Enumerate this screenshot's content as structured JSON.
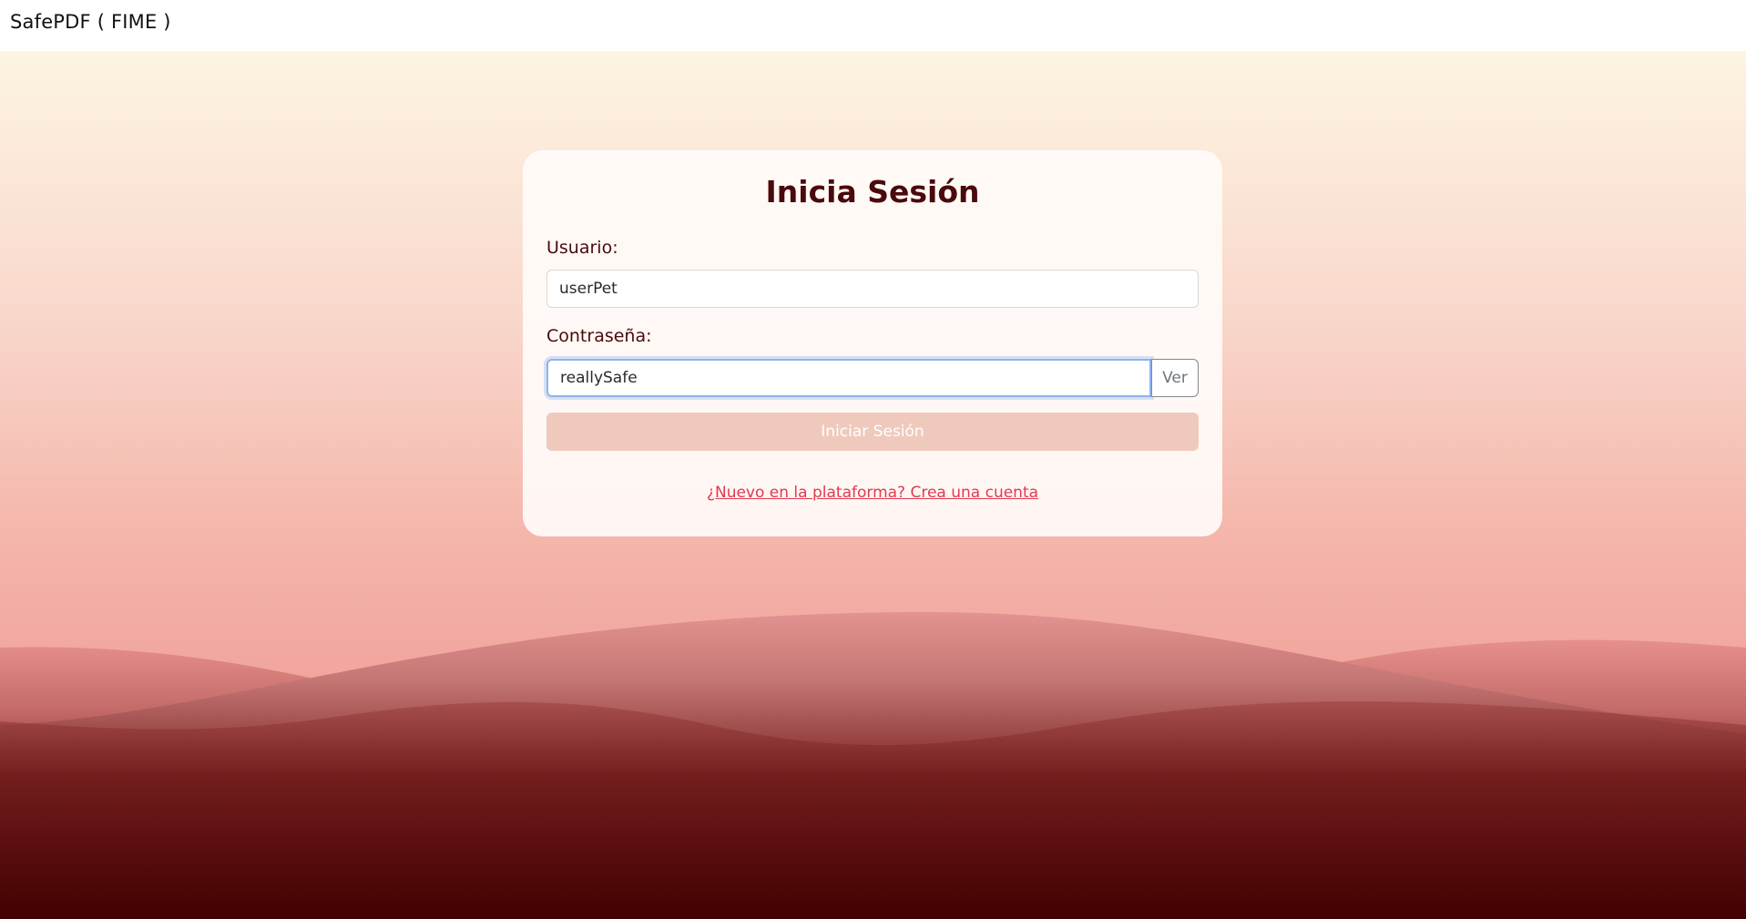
{
  "app": {
    "brand": "SafePDF ( FIME )"
  },
  "login": {
    "title": "Inicia Sesión",
    "username_label": "Usuario:",
    "username_value": "userPet",
    "password_label": "Contraseña:",
    "password_value": "reallySafe",
    "show_password_label": "Ver",
    "submit_label": "Iniciar Sesión",
    "signup_link": "¿Nuevo en la plataforma? Crea una cuenta"
  },
  "colors": {
    "title": "#4a0a0c",
    "link": "#e2394f",
    "submit_disabled": "#f0c9bd",
    "focus_ring": "#8db3ef",
    "background_bottom": "#420000"
  }
}
